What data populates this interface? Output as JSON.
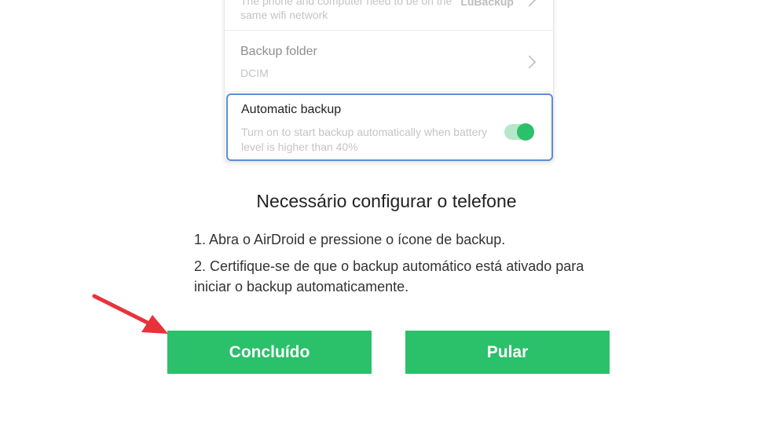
{
  "phone_settings": {
    "wifi_row": {
      "desc": "The phone and computer need to be on the same wifi network",
      "value": "LuBackup"
    },
    "folder_row": {
      "title": "Backup folder",
      "desc": "DCIM"
    },
    "auto_backup": {
      "title": "Automatic backup",
      "desc": "Turn on to start backup automatically when battery level is higher than 40%",
      "enabled": true
    }
  },
  "instructions": {
    "heading": "Necessário configurar o telefone",
    "steps": [
      "1. Abra o AirDroid e pressione o ícone de backup.",
      "2. Certifique-se de que o backup automático está ativado para iniciar o backup automaticamente."
    ]
  },
  "buttons": {
    "done_label": "Concluído",
    "skip_label": "Pular"
  },
  "colors": {
    "accent_green": "#2bc06a",
    "highlight_border": "#5b8fd6",
    "annotation_red": "#e8323a"
  },
  "annotation": {
    "icon": "red-arrow-icon"
  }
}
